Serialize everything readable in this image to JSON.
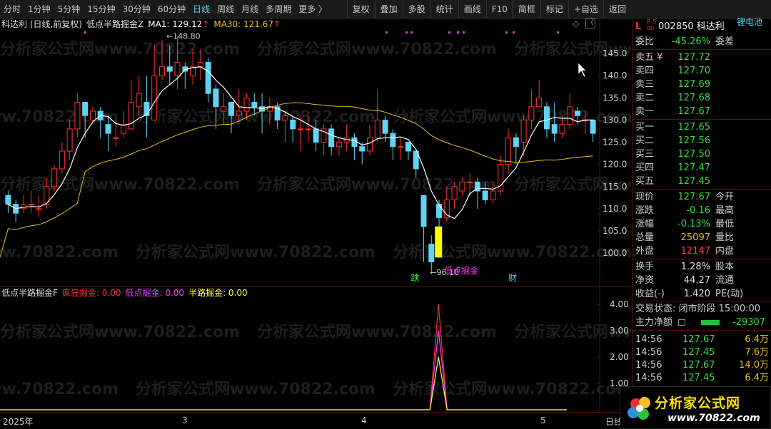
{
  "toolbar": {
    "timeframes": [
      "分时",
      "1分钟",
      "5分钟",
      "15分钟",
      "30分钟",
      "60分钟",
      "日线",
      "周线",
      "月线",
      "多周期",
      "更多 〉"
    ],
    "active_timeframe": "日线",
    "buttons": [
      "复权",
      "叠加",
      "多股",
      "统计",
      "画线",
      "F10",
      "简框",
      "标记",
      "+自选",
      "返回"
    ]
  },
  "main_header": {
    "stock_label": "科达利 (日线,前复权)",
    "indicator_name": "低点半路掘金Z",
    "ma1_label": "MA1: 129.12",
    "ma30_label": "MA30: 121.67",
    "arrow": "↑",
    "corner_icon": "◇",
    "corner_btn": "〈"
  },
  "sub_header": {
    "indicator": "低点半路掘金F",
    "crazy": "疯狂掘金: 0.00",
    "low": "低点掘金: 0.00",
    "half": "半路掘金: 0.00"
  },
  "annotations": {
    "high_label": "148.80",
    "low_label": "96.10",
    "signal_text": "低点掘金",
    "mark_die": "跌",
    "mark_cai": "财"
  },
  "x_axis": {
    "labels": [
      "2025年",
      "3",
      "4",
      "5"
    ],
    "right_label": "日线"
  },
  "y_axis_main": [
    "145.0",
    "140.0",
    "135.0",
    "130.0",
    "125.0",
    "120.0",
    "115.0",
    "110.0",
    "105.0",
    "100.0"
  ],
  "y_axis_sub": [
    "4.00",
    "3.00",
    "2.00",
    "1.00"
  ],
  "watermark": "分析家公式网www.70822.com",
  "quote": {
    "code_name": "002850 科达利",
    "tag": "锂电池",
    "l_icon": "L",
    "r_icon": "R 500",
    "weibi": {
      "label": "委比",
      "value": "-45.26%",
      "label2": "委差"
    },
    "sells": [
      {
        "label": "卖五 ¥",
        "price": "127.72"
      },
      {
        "label": "卖四",
        "price": "127.70"
      },
      {
        "label": "卖三",
        "price": "127.69"
      },
      {
        "label": "卖二",
        "price": "127.68"
      },
      {
        "label": "卖一",
        "price": "127.67"
      }
    ],
    "buys": [
      {
        "label": "买一",
        "price": "127.65"
      },
      {
        "label": "买二",
        "price": "127.56"
      },
      {
        "label": "买三",
        "price": "127.50"
      },
      {
        "label": "买四",
        "price": "127.47"
      },
      {
        "label": "买五",
        "price": "127.45"
      }
    ],
    "stats": [
      {
        "label": "现价",
        "value": "127.67",
        "label2": "今开",
        "color": "g"
      },
      {
        "label": "涨跌",
        "value": "-0.16",
        "label2": "最高",
        "color": "g"
      },
      {
        "label": "涨幅",
        "value": "-0.13%",
        "label2": "最低",
        "color": "g"
      },
      {
        "label": "总量",
        "value": "25097",
        "label2": "量比",
        "color": "y"
      },
      {
        "label": "外盘",
        "value": "12147",
        "label2": "内盘",
        "color": "r"
      }
    ],
    "stats2": [
      {
        "label": "换手",
        "value": "1.28%",
        "label2": "股本",
        "color": "w"
      },
      {
        "label": "净资",
        "value": "44.27",
        "label2": "流通",
        "color": "w"
      },
      {
        "label": "收益(-)",
        "value": "1.420",
        "label2": "PE(动)",
        "color": "w"
      }
    ],
    "status": "交易状态: 闭市阶段 15:00:00",
    "main_flow": {
      "label": "主力净额",
      "value": "-29307"
    },
    "ticks": [
      {
        "time": "14:56",
        "price": "127.67",
        "vol": "6.4万"
      },
      {
        "time": "14:56",
        "price": "127.45",
        "vol": "7.6万"
      },
      {
        "time": "14:56",
        "price": "127.67",
        "vol": "14.0万"
      },
      {
        "time": "14:56",
        "price": "127.45",
        "vol": "6.4万"
      },
      {
        "time": "14:56",
        "price": "127.46",
        "vol": "2.5万"
      },
      {
        "time": "14:56",
        "price": "127.46",
        "vol": "8.9万"
      }
    ]
  },
  "logo": {
    "text": "分析家公式网",
    "url": "www.70822.com"
  },
  "colors": {
    "up": "#ff3030",
    "down": "#5fd4f4",
    "ma1": "#ffffff",
    "ma30": "#e8c020",
    "signal_yellow": "#ffff00",
    "magenta": "#ff40ff"
  },
  "chart_data": {
    "type": "candlestick",
    "y_range": [
      96,
      150
    ],
    "candles": [
      [
        113,
        111,
        114,
        109
      ],
      [
        111,
        109,
        112,
        107
      ],
      [
        110,
        111,
        113,
        109
      ],
      [
        111,
        111,
        114,
        109
      ],
      [
        110,
        110,
        113,
        108
      ],
      [
        111,
        115,
        117,
        110
      ],
      [
        115,
        119,
        120,
        114
      ],
      [
        119,
        123,
        125,
        118
      ],
      [
        123,
        128,
        130,
        121
      ],
      [
        128,
        134,
        136,
        126
      ],
      [
        134,
        131,
        134,
        126
      ],
      [
        130,
        132,
        133,
        129
      ],
      [
        132,
        130,
        133,
        126
      ],
      [
        129,
        127,
        131,
        123
      ],
      [
        126,
        126,
        130,
        124
      ],
      [
        127,
        129,
        132,
        126
      ],
      [
        128,
        134,
        139,
        128
      ],
      [
        133,
        136,
        140,
        131
      ],
      [
        134,
        131,
        140,
        126
      ],
      [
        130,
        140,
        147,
        135
      ],
      [
        140,
        142,
        148,
        139
      ],
      [
        142,
        141,
        147,
        138
      ],
      [
        140,
        143,
        149,
        137
      ],
      [
        142,
        141,
        143,
        137
      ],
      [
        140,
        142,
        146,
        138
      ],
      [
        142,
        143,
        146,
        139
      ],
      [
        143,
        136,
        144,
        134
      ],
      [
        137,
        133,
        138,
        128
      ],
      [
        132,
        133,
        136,
        129
      ],
      [
        134,
        131,
        134,
        127
      ],
      [
        131,
        132,
        137,
        129
      ],
      [
        132,
        135,
        136,
        130
      ],
      [
        134,
        133,
        136,
        131
      ],
      [
        133,
        132,
        136,
        127
      ],
      [
        132,
        133,
        135,
        129
      ],
      [
        133,
        130,
        134,
        128
      ],
      [
        130,
        131,
        132,
        125
      ],
      [
        130,
        128,
        131,
        125
      ],
      [
        128,
        128,
        131,
        123
      ],
      [
        128,
        128,
        131,
        125
      ],
      [
        128,
        125,
        130,
        123
      ],
      [
        125,
        128,
        129,
        122
      ],
      [
        128,
        124,
        129,
        122
      ],
      [
        124,
        125,
        126,
        122
      ],
      [
        125,
        126,
        129,
        123
      ],
      [
        126,
        124,
        127,
        121
      ],
      [
        124,
        123,
        125,
        120
      ],
      [
        123,
        126,
        129,
        122
      ],
      [
        126,
        130,
        137,
        125
      ],
      [
        130,
        127,
        131,
        125
      ],
      [
        127,
        124,
        128,
        121
      ],
      [
        124,
        124,
        126,
        121
      ],
      [
        125,
        123,
        125,
        121
      ],
      [
        123,
        119,
        123,
        117
      ],
      [
        113,
        106,
        109,
        98
      ],
      [
        102,
        98,
        104,
        96
      ],
      [
        111,
        108,
        112,
        106
      ],
      [
        108,
        112,
        115,
        107
      ],
      [
        112,
        115,
        116,
        110
      ],
      [
        114,
        116,
        117,
        113
      ],
      [
        116,
        116,
        118,
        113
      ],
      [
        116,
        114,
        117,
        110
      ],
      [
        114,
        112,
        116,
        111
      ],
      [
        112,
        114,
        116,
        111
      ],
      [
        114,
        120,
        122,
        113
      ],
      [
        120,
        126,
        128,
        118
      ],
      [
        126,
        124,
        127,
        120
      ],
      [
        125,
        130,
        131,
        122
      ],
      [
        130,
        133,
        137,
        128
      ],
      [
        133,
        135,
        139,
        133
      ],
      [
        133,
        128,
        134,
        126
      ],
      [
        129,
        127,
        134,
        125
      ],
      [
        127,
        129,
        131,
        126
      ],
      [
        129,
        133,
        136,
        128
      ],
      [
        132,
        131,
        133,
        129
      ],
      [
        130,
        130,
        132,
        127
      ],
      [
        130,
        127,
        130,
        125
      ]
    ]
  }
}
